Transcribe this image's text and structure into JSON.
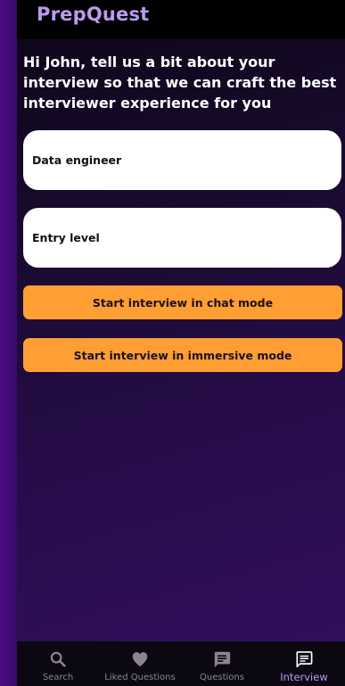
{
  "app": {
    "brand": "PrepQuest"
  },
  "intro": {
    "message": "Hi John, tell us a bit about your interview so that we can craft the best interviewer experience for you"
  },
  "form": {
    "role_value": "Data engineer",
    "level_value": "Entry level"
  },
  "actions": {
    "chat_label": "Start interview in chat mode",
    "immersive_label": "Start interview in immersive mode"
  },
  "nav": {
    "active": "Interview",
    "items": [
      {
        "label": "Search",
        "icon": "search-icon"
      },
      {
        "label": "Liked Questions",
        "icon": "heart-icon"
      },
      {
        "label": "Questions",
        "icon": "chat-bubble-icon"
      },
      {
        "label": "Interview",
        "icon": "chat-bubble-icon"
      }
    ]
  },
  "colors": {
    "accent": "#ff9e33",
    "brand": "#b79cf0",
    "nav_background": "#0b0812",
    "nav_inactive": "#8a8494",
    "background": "#3e0a6e"
  }
}
